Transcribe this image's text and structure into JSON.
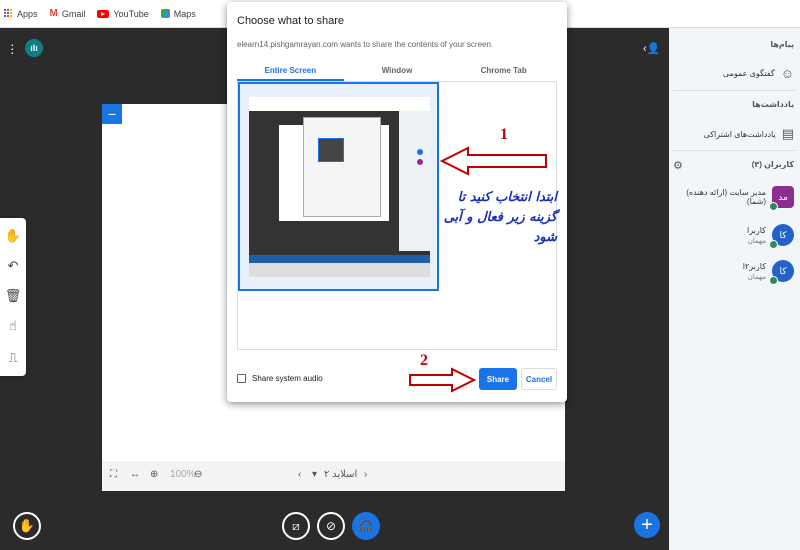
{
  "bookmarks": [
    {
      "label": "Apps",
      "icon": "apps-grid-icon"
    },
    {
      "label": "Gmail",
      "icon": "gmail-icon"
    },
    {
      "label": "YouTube",
      "icon": "youtube-icon"
    },
    {
      "label": "Maps",
      "icon": "maps-icon"
    }
  ],
  "dialog": {
    "title": "Choose what to share",
    "subtitle": "elearn14.pishgamrayan.com wants to share the contents of your screen.",
    "tabs": [
      "Entire Screen",
      "Window",
      "Chrome Tab"
    ],
    "active_tab": "Entire Screen",
    "audio_label": "Share system audio",
    "share_label": "Share",
    "cancel_label": "Cancel"
  },
  "annotations": {
    "step1": "1",
    "step2": "2",
    "instruction": "ابتدا انتخاب کنید تا گزینه زیر فعال و آبی شود"
  },
  "slide_bar": {
    "slide_label": "اسلاید ۲",
    "zoom_value": "100%"
  },
  "sidebar": {
    "messages_heading": "پیام‌ها",
    "public_chat": "گفتگوی عمومی",
    "notes_heading": "یادداشت‌ها",
    "shared_notes": "یادداشت‌های اشتراکی",
    "users_heading": "کاربران (۳)",
    "users": [
      {
        "initials": "مد",
        "name": "مدیر سایت (ارائه دهنده)(شما)",
        "role": ""
      },
      {
        "initials": "کا",
        "name": "کاربرا",
        "role": "مهمان"
      },
      {
        "initials": "کا",
        "name": "کاربر۲ا",
        "role": "مهمان"
      }
    ]
  },
  "colors": {
    "accent": "#1a73e8",
    "annotation_red": "#c00000",
    "annotation_blue": "#1a2fb8"
  }
}
